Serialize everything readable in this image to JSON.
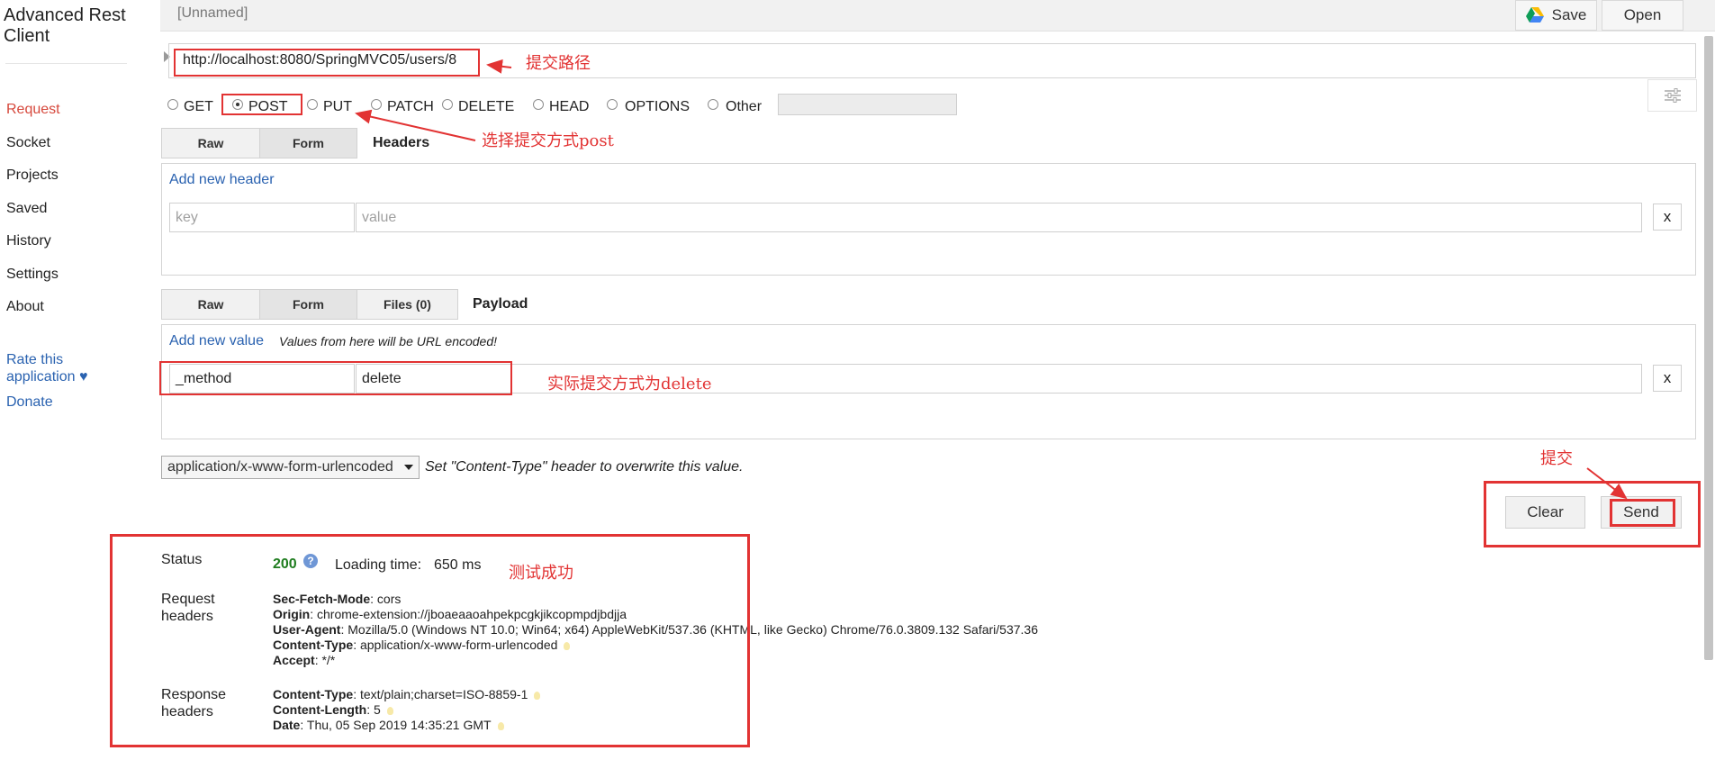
{
  "app": {
    "title_line1": "Advanced Rest",
    "title_line2": "Client"
  },
  "sidebar": {
    "items": [
      {
        "label": "Request",
        "active": true
      },
      {
        "label": "Socket"
      },
      {
        "label": "Projects"
      },
      {
        "label": "Saved"
      },
      {
        "label": "History"
      },
      {
        "label": "Settings"
      },
      {
        "label": "About"
      }
    ],
    "rate_line1": "Rate this",
    "rate_line2": "application ♥",
    "donate": "Donate"
  },
  "toolbar": {
    "doc_name": "[Unnamed]",
    "save_label": "Save",
    "open_label": "Open"
  },
  "request": {
    "url": "http://localhost:8080/SpringMVC05/users/8",
    "methods": [
      "GET",
      "POST",
      "PUT",
      "PATCH",
      "DELETE",
      "HEAD",
      "OPTIONS",
      "Other"
    ],
    "selected_method": "POST"
  },
  "headers": {
    "tabs": [
      "Raw",
      "Form"
    ],
    "title": "Headers",
    "add_link": "Add new header",
    "key_placeholder": "key",
    "value_placeholder": "value",
    "remove_label": "x"
  },
  "payload": {
    "tabs": [
      "Raw",
      "Form",
      "Files (0)"
    ],
    "title": "Payload",
    "add_link": "Add new value",
    "note": "Values from here will be URL encoded!",
    "key": "_method",
    "value": "delete",
    "remove_label": "x",
    "content_type": "application/x-www-form-urlencoded",
    "content_type_hint": "Set \"Content-Type\" header to overwrite this value."
  },
  "actions": {
    "clear_label": "Clear",
    "send_label": "Send"
  },
  "response": {
    "status_label": "Status",
    "status_code": "200",
    "help_icon": "?",
    "loading_label": "Loading time:",
    "loading_value": "650 ms",
    "request_headers_label_line1": "Request",
    "request_headers_label_line2": "headers",
    "request_headers": [
      {
        "name": "Sec-Fetch-Mode",
        "value": "cors"
      },
      {
        "name": "Origin",
        "value": "chrome-extension://jboaeaaoahpekpcgkjikcopmpdjbdjja"
      },
      {
        "name": "User-Agent",
        "value": "Mozilla/5.0 (Windows NT 10.0; Win64; x64) AppleWebKit/537.36 (KHTML, like Gecko) Chrome/76.0.3809.132 Safari/537.36"
      },
      {
        "name": "Content-Type",
        "value": "application/x-www-form-urlencoded"
      },
      {
        "name": "Accept",
        "value": "*/*"
      }
    ],
    "response_headers_label_line1": "Response",
    "response_headers_label_line2": "headers",
    "response_headers": [
      {
        "name": "Content-Type",
        "value": "text/plain;charset=ISO-8859-1"
      },
      {
        "name": "Content-Length",
        "value": "5"
      },
      {
        "name": "Date",
        "value": "Thu, 05 Sep 2019 14:35:21 GMT"
      }
    ]
  },
  "annotations": {
    "url_note": "提交路径",
    "method_note": "选择提交方式post",
    "actual_method_note": "实际提交方式为delete",
    "submit_note": "提交",
    "success_note": "测试成功",
    "color": "#e23333"
  },
  "icons": [
    "google-drive-icon",
    "sliders-icon",
    "help-icon",
    "url-expand-icon",
    "dropdown-caret-icon",
    "lightbulb-icon"
  ]
}
